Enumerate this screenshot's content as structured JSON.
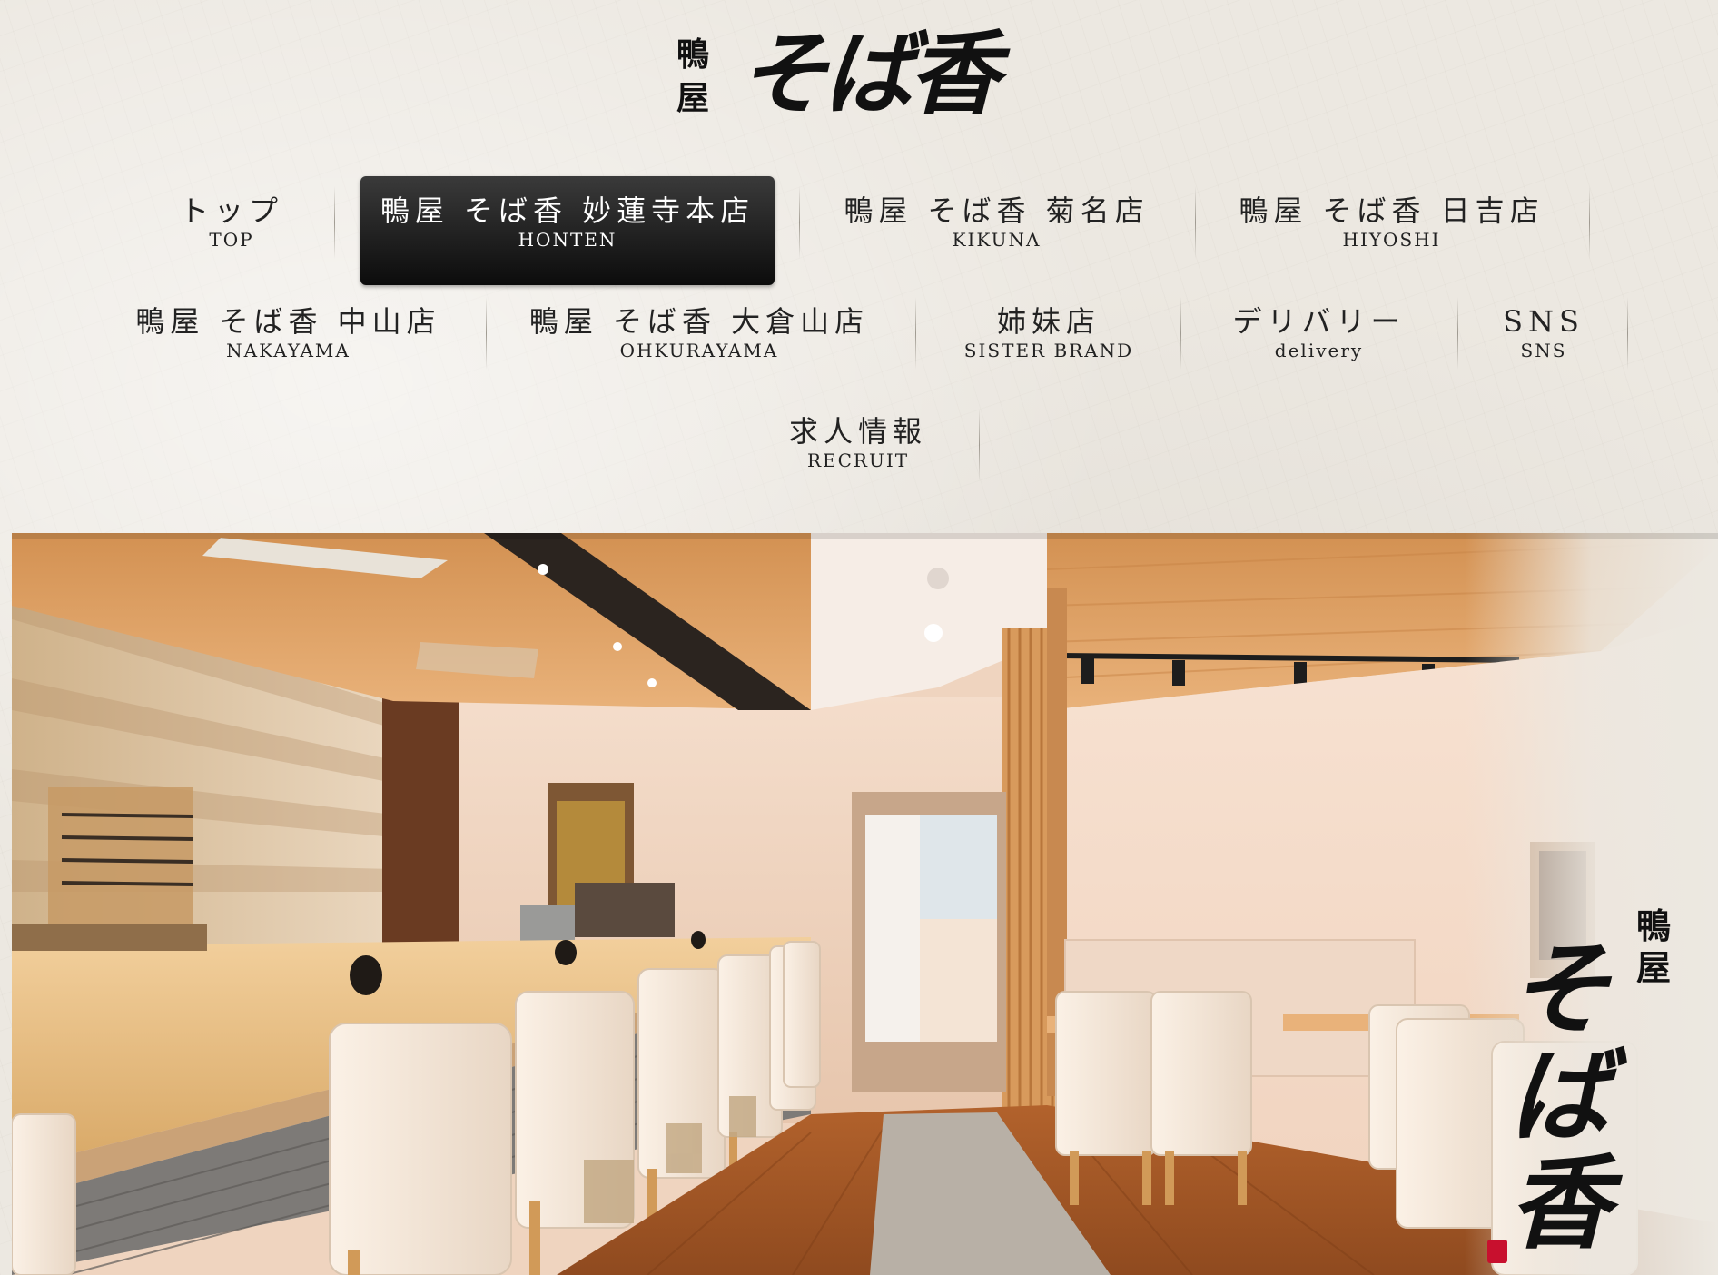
{
  "logo": {
    "small": "鴨屋",
    "main": "そば香"
  },
  "nav": {
    "items": [
      {
        "jp": "トップ",
        "en": "TOP"
      },
      {
        "jp": "鴨屋 そば香 妙蓮寺本店",
        "en": "HONTEN"
      },
      {
        "jp": "鴨屋 そば香 菊名店",
        "en": "KIKUNA"
      },
      {
        "jp": "鴨屋 そば香 日吉店",
        "en": "HIYOSHI"
      },
      {
        "jp": "鴨屋 そば香 中山店",
        "en": "NAKAYAMA"
      },
      {
        "jp": "鴨屋 そば香 大倉山店",
        "en": "OHKURAYAMA"
      },
      {
        "jp": "姉妹店",
        "en": "SISTER BRAND"
      },
      {
        "jp": "デリバリー",
        "en": "delivery"
      },
      {
        "jp": "SNS",
        "en": "SNS"
      },
      {
        "jp": "求人情報",
        "en": "RECRUIT"
      }
    ],
    "active_index": 1
  },
  "hero": {
    "logo_small": "鴨屋",
    "logo_main": "そば香"
  },
  "colors": {
    "paper_background": "#ece8e1",
    "active_tab": "#111111",
    "text": "#222222"
  }
}
